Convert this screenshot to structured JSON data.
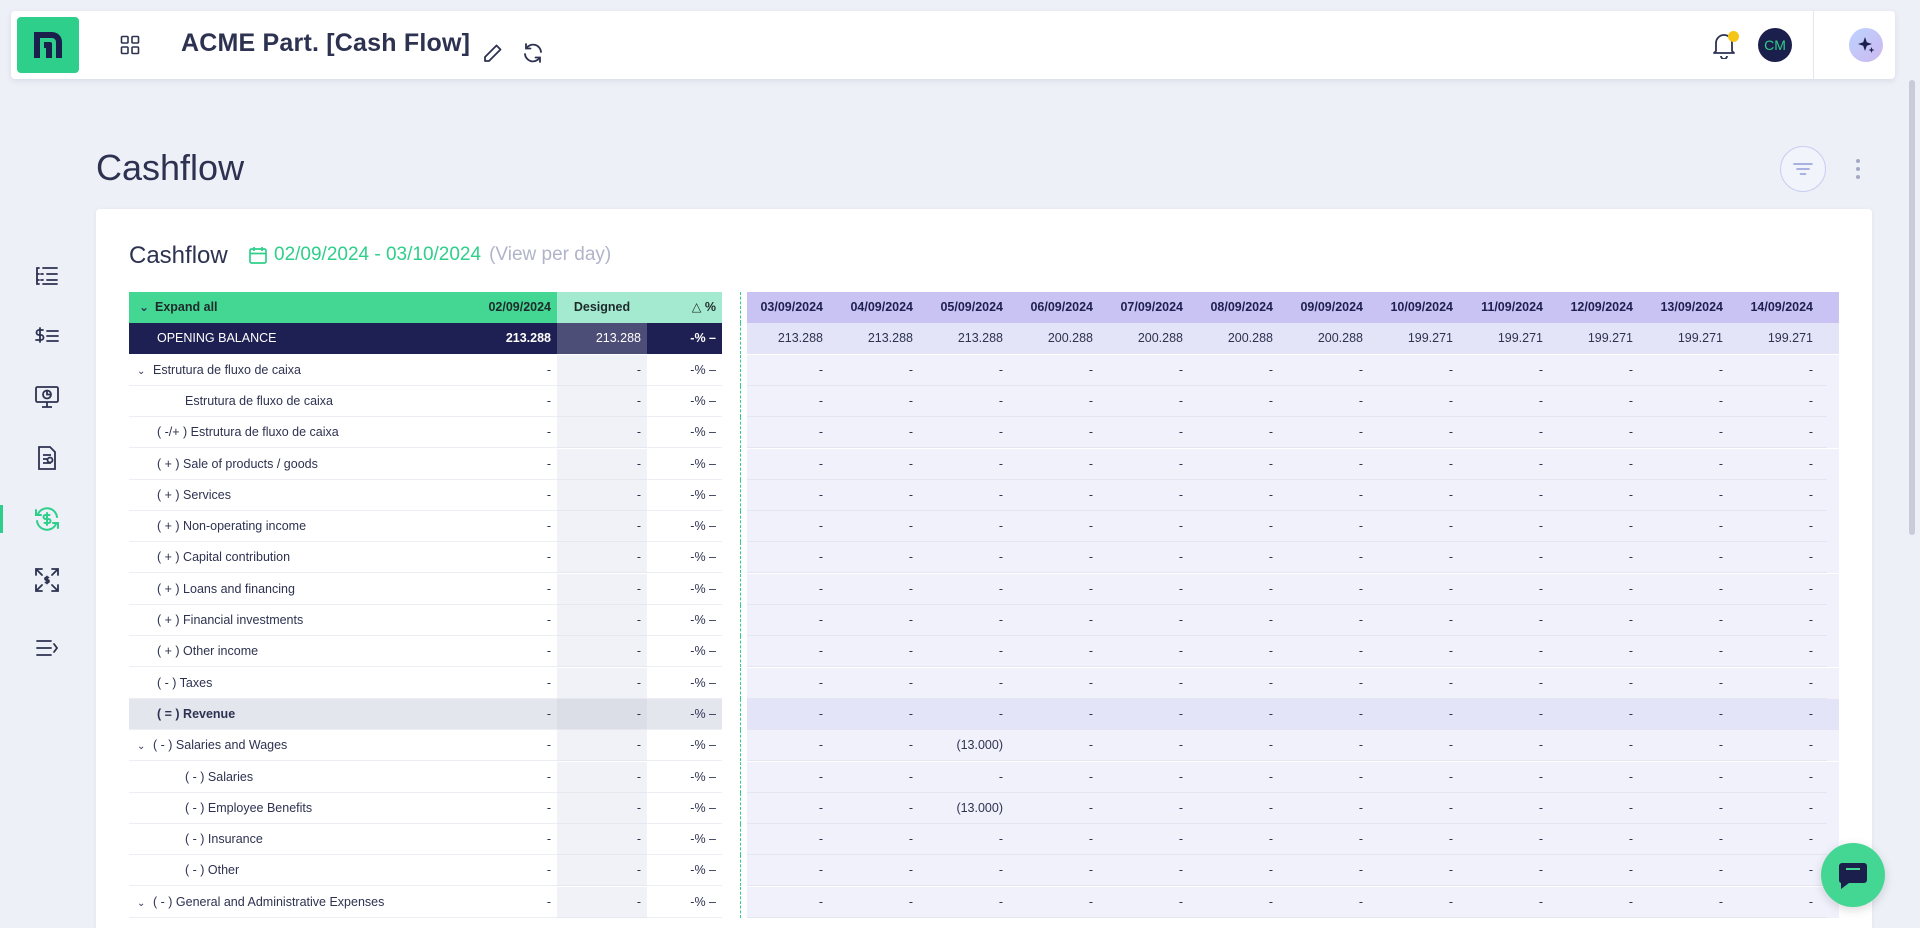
{
  "topbar": {
    "title": "ACME Part. [Cash Flow]",
    "avatar_initials": "CM",
    "icons": [
      "logo-icon",
      "apps-grid-icon",
      "edit-icon",
      "refresh-icon",
      "bell-icon",
      "ai-sparkle-icon"
    ]
  },
  "sidenav": {
    "items": [
      "list-icon",
      "money-list-icon",
      "dashboard-icon",
      "report-icon",
      "cashflow-icon",
      "expand-icon",
      "menu-collapse-icon"
    ],
    "active_index": 4
  },
  "page": {
    "title": "Cashflow"
  },
  "card": {
    "title": "Cashflow",
    "date_range": "02/09/2024 - 03/10/2024",
    "view_mode": "(View per day)"
  },
  "table": {
    "header": {
      "expand_all": "Expand all",
      "first_date": "02/09/2024",
      "designed": "Designed",
      "delta": "%",
      "dates": [
        "03/09/2024",
        "04/09/2024",
        "05/09/2024",
        "06/09/2024",
        "07/09/2024",
        "08/09/2024",
        "09/09/2024",
        "10/09/2024",
        "11/09/2024",
        "12/09/2024",
        "13/09/2024",
        "14/09/2024"
      ]
    },
    "opening_balance": {
      "label": "OPENING BALANCE",
      "first": "213.288",
      "designed": "213.288",
      "pct": "-%",
      "values": [
        "213.288",
        "213.288",
        "213.288",
        "200.288",
        "200.288",
        "200.288",
        "200.288",
        "199.271",
        "199.271",
        "199.271",
        "199.271",
        "199.271"
      ]
    },
    "rows": [
      {
        "label": "Estrutura de fluxo de caixa",
        "indent": 0,
        "chevron": true,
        "bold": false,
        "revenue": false,
        "first": "-",
        "designed": "-",
        "pct": "-%",
        "values": [
          "-",
          "-",
          "-",
          "-",
          "-",
          "-",
          "-",
          "-",
          "-",
          "-",
          "-",
          "-"
        ]
      },
      {
        "label": "Estrutura de fluxo de caixa",
        "indent": 2,
        "chevron": false,
        "bold": false,
        "revenue": false,
        "first": "-",
        "designed": "-",
        "pct": "-%",
        "values": [
          "-",
          "-",
          "-",
          "-",
          "-",
          "-",
          "-",
          "-",
          "-",
          "-",
          "-",
          "-"
        ]
      },
      {
        "label": "( -/+ ) Estrutura de fluxo de caixa",
        "indent": 1,
        "chevron": false,
        "bold": false,
        "revenue": false,
        "first": "-",
        "designed": "-",
        "pct": "-%",
        "values": [
          "-",
          "-",
          "-",
          "-",
          "-",
          "-",
          "-",
          "-",
          "-",
          "-",
          "-",
          "-"
        ]
      },
      {
        "label": "( + ) Sale of products / goods",
        "indent": 1,
        "chevron": false,
        "bold": false,
        "revenue": false,
        "first": "-",
        "designed": "-",
        "pct": "-%",
        "values": [
          "-",
          "-",
          "-",
          "-",
          "-",
          "-",
          "-",
          "-",
          "-",
          "-",
          "-",
          "-"
        ]
      },
      {
        "label": "( + ) Services",
        "indent": 1,
        "chevron": false,
        "bold": false,
        "revenue": false,
        "first": "-",
        "designed": "-",
        "pct": "-%",
        "values": [
          "-",
          "-",
          "-",
          "-",
          "-",
          "-",
          "-",
          "-",
          "-",
          "-",
          "-",
          "-"
        ]
      },
      {
        "label": "( + ) Non-operating income",
        "indent": 1,
        "chevron": false,
        "bold": false,
        "revenue": false,
        "first": "-",
        "designed": "-",
        "pct": "-%",
        "values": [
          "-",
          "-",
          "-",
          "-",
          "-",
          "-",
          "-",
          "-",
          "-",
          "-",
          "-",
          "-"
        ]
      },
      {
        "label": "( + ) Capital contribution",
        "indent": 1,
        "chevron": false,
        "bold": false,
        "revenue": false,
        "first": "-",
        "designed": "-",
        "pct": "-%",
        "values": [
          "-",
          "-",
          "-",
          "-",
          "-",
          "-",
          "-",
          "-",
          "-",
          "-",
          "-",
          "-"
        ]
      },
      {
        "label": "( + ) Loans and financing",
        "indent": 1,
        "chevron": false,
        "bold": false,
        "revenue": false,
        "first": "-",
        "designed": "-",
        "pct": "-%",
        "values": [
          "-",
          "-",
          "-",
          "-",
          "-",
          "-",
          "-",
          "-",
          "-",
          "-",
          "-",
          "-"
        ]
      },
      {
        "label": "( + ) Financial investments",
        "indent": 1,
        "chevron": false,
        "bold": false,
        "revenue": false,
        "first": "-",
        "designed": "-",
        "pct": "-%",
        "values": [
          "-",
          "-",
          "-",
          "-",
          "-",
          "-",
          "-",
          "-",
          "-",
          "-",
          "-",
          "-"
        ]
      },
      {
        "label": "( + ) Other income",
        "indent": 1,
        "chevron": false,
        "bold": false,
        "revenue": false,
        "first": "-",
        "designed": "-",
        "pct": "-%",
        "values": [
          "-",
          "-",
          "-",
          "-",
          "-",
          "-",
          "-",
          "-",
          "-",
          "-",
          "-",
          "-"
        ]
      },
      {
        "label": "( - ) Taxes",
        "indent": 1,
        "chevron": false,
        "bold": false,
        "revenue": false,
        "first": "-",
        "designed": "-",
        "pct": "-%",
        "values": [
          "-",
          "-",
          "-",
          "-",
          "-",
          "-",
          "-",
          "-",
          "-",
          "-",
          "-",
          "-"
        ]
      },
      {
        "label": "( = ) Revenue",
        "indent": 1,
        "chevron": false,
        "bold": true,
        "revenue": true,
        "first": "-",
        "designed": "-",
        "pct": "-%",
        "values": [
          "-",
          "-",
          "-",
          "-",
          "-",
          "-",
          "-",
          "-",
          "-",
          "-",
          "-",
          "-"
        ]
      },
      {
        "label": "( - ) Salaries and Wages",
        "indent": 0,
        "chevron": true,
        "bold": false,
        "revenue": false,
        "first": "-",
        "designed": "-",
        "pct": "-%",
        "values": [
          "-",
          "-",
          "(13.000)",
          "-",
          "-",
          "-",
          "-",
          "-",
          "-",
          "-",
          "-",
          "-"
        ]
      },
      {
        "label": "( - ) Salaries",
        "indent": 2,
        "chevron": false,
        "bold": false,
        "revenue": false,
        "first": "-",
        "designed": "-",
        "pct": "-%",
        "values": [
          "-",
          "-",
          "-",
          "-",
          "-",
          "-",
          "-",
          "-",
          "-",
          "-",
          "-",
          "-"
        ]
      },
      {
        "label": "( - ) Employee Benefits",
        "indent": 2,
        "chevron": false,
        "bold": false,
        "revenue": false,
        "first": "-",
        "designed": "-",
        "pct": "-%",
        "values": [
          "-",
          "-",
          "(13.000)",
          "-",
          "-",
          "-",
          "-",
          "-",
          "-",
          "-",
          "-",
          "-"
        ]
      },
      {
        "label": "( - ) Insurance",
        "indent": 2,
        "chevron": false,
        "bold": false,
        "revenue": false,
        "first": "-",
        "designed": "-",
        "pct": "-%",
        "values": [
          "-",
          "-",
          "-",
          "-",
          "-",
          "-",
          "-",
          "-",
          "-",
          "-",
          "-",
          "-"
        ]
      },
      {
        "label": "( - ) Other",
        "indent": 2,
        "chevron": false,
        "bold": false,
        "revenue": false,
        "first": "-",
        "designed": "-",
        "pct": "-%",
        "values": [
          "-",
          "-",
          "-",
          "-",
          "-",
          "-",
          "-",
          "-",
          "-",
          "-",
          "-",
          "-"
        ]
      },
      {
        "label": "( - ) General and Administrative Expenses",
        "indent": 0,
        "chevron": true,
        "bold": false,
        "revenue": false,
        "first": "-",
        "designed": "-",
        "pct": "-%",
        "values": [
          "-",
          "-",
          "-",
          "-",
          "-",
          "-",
          "-",
          "-",
          "-",
          "-",
          "-",
          "-"
        ]
      }
    ]
  },
  "colors": {
    "brand_green": "#2ecf8a",
    "header_green": "#44d794",
    "navy": "#1e1f52",
    "lavender": "#c9c3f3"
  }
}
